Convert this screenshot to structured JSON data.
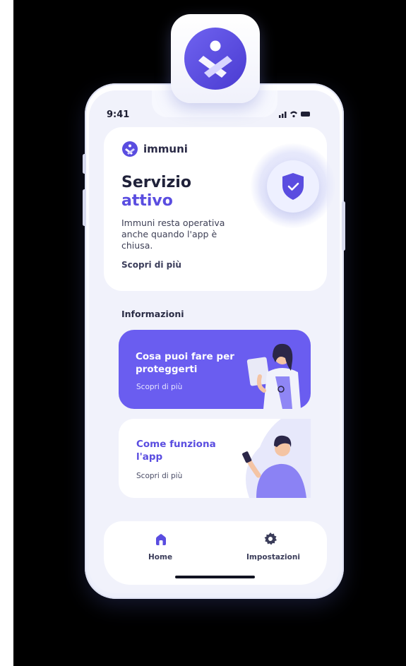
{
  "status_bar": {
    "time": "9:41",
    "icons": "signal wifi battery"
  },
  "app": {
    "name": "immuni",
    "icon": "immuni-logo-icon"
  },
  "hero": {
    "title_line1": "Servizio",
    "title_line2": "attivo",
    "description": "Immuni resta operativa anche quando l'app è chiusa.",
    "link": "Scopri di più",
    "badge_icon": "shield-check-icon"
  },
  "info": {
    "section_label": "Informazioni",
    "cards": [
      {
        "title": "Cosa puoi fare per proteggerti",
        "link": "Scopri di più",
        "illustration": "doctor-illustration"
      },
      {
        "title": "Come funziona l'app",
        "link": "Scopri di più",
        "illustration": "person-phone-illustration"
      }
    ]
  },
  "tabbar": {
    "tabs": [
      {
        "label": "Home",
        "icon": "home-icon"
      },
      {
        "label": "Impostazioni",
        "icon": "gear-icon"
      }
    ]
  },
  "colors": {
    "accent": "#5a4de0",
    "promo_bg": "#6a5df0",
    "background": "#f1f2fb",
    "text_dark": "#20223a"
  }
}
